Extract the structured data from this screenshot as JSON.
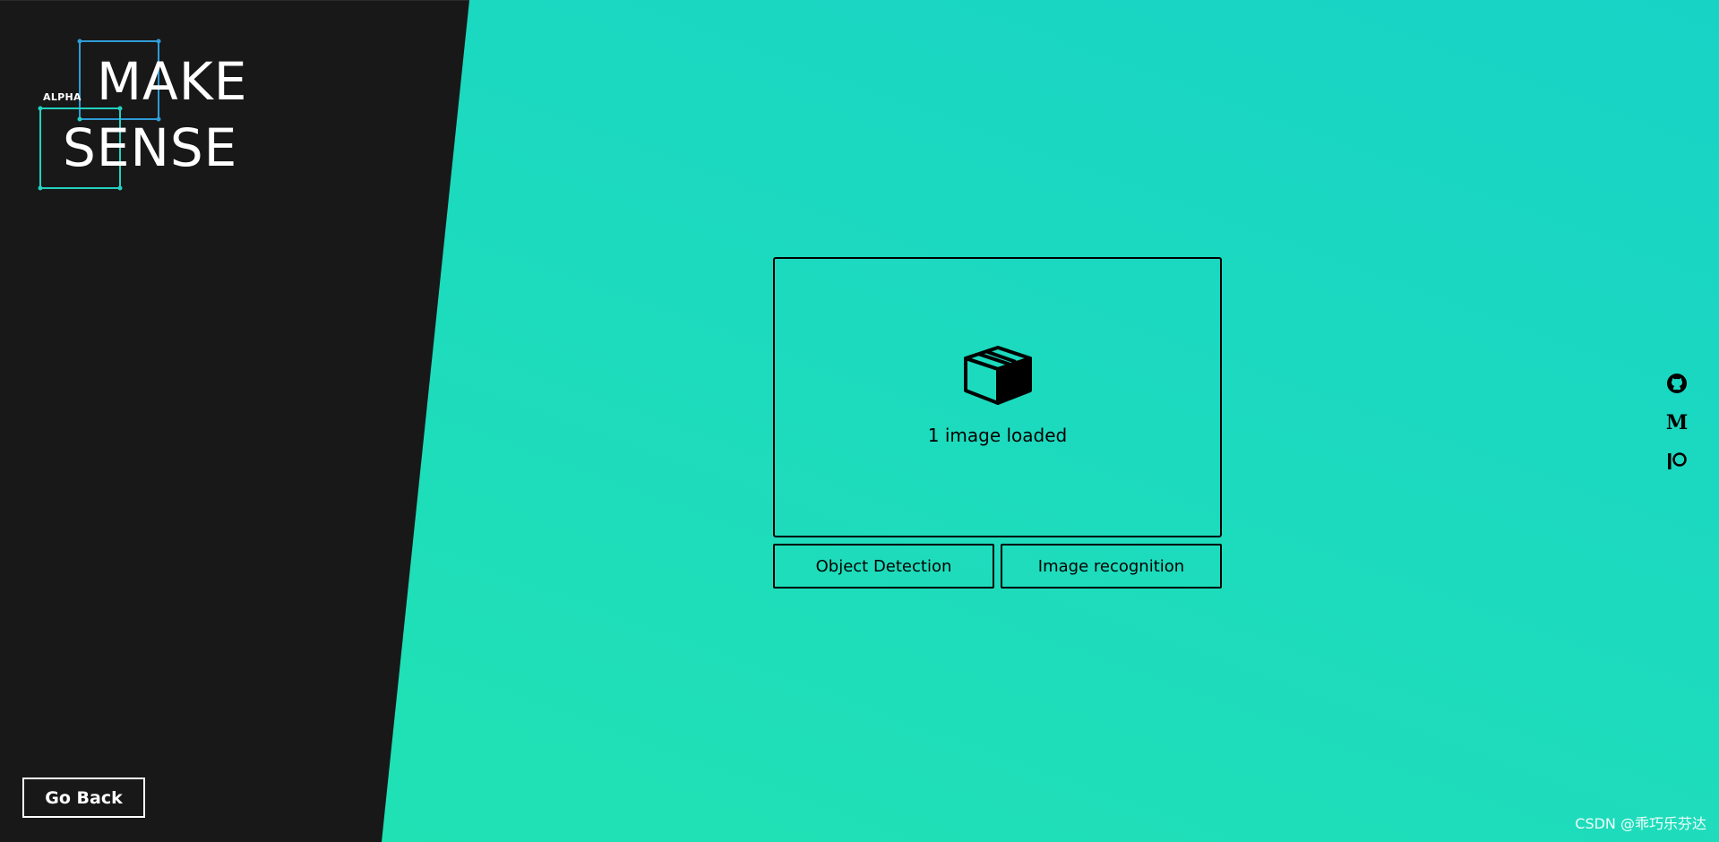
{
  "logo": {
    "badge": "ALPHA",
    "line1": "MAKE",
    "line2": "SENSE"
  },
  "navigation": {
    "go_back_label": "Go Back"
  },
  "drop_zone": {
    "icon": "box-icon",
    "status_text": "1 image loaded"
  },
  "project_types": [
    {
      "label": "Object Detection"
    },
    {
      "label": "Image recognition"
    }
  ],
  "social": {
    "github_icon": "github-icon",
    "medium_letter": "M",
    "patreon_icon": "patreon-icon"
  },
  "watermark": "CSDN @乖巧乐芬达",
  "colors": {
    "left_panel": "#181818",
    "gradient_top": "#17d3c6",
    "gradient_bottom": "#21e3b2",
    "logo_blue": "#2f9bd6",
    "logo_teal": "#24d0c0"
  }
}
